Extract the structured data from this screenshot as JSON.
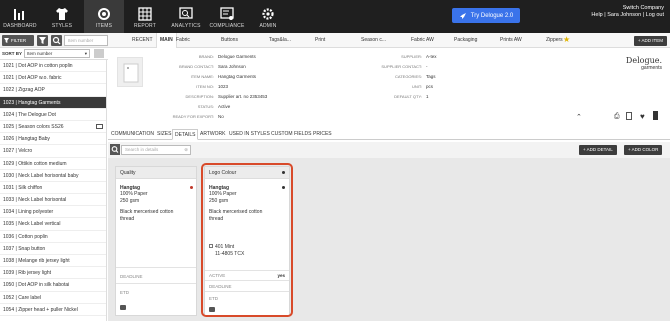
{
  "topnav": {
    "items": [
      {
        "label": "DASHBOARD",
        "icon": "dashboard-icon"
      },
      {
        "label": "STYLES",
        "icon": "tshirt-icon"
      },
      {
        "label": "ITEMS",
        "icon": "items-gear-icon"
      },
      {
        "label": "REPORT",
        "icon": "report-grid-icon"
      },
      {
        "label": "ANALYTICS",
        "icon": "analytics-icon"
      },
      {
        "label": "COMPLIANCE",
        "icon": "compliance-icon"
      },
      {
        "label": "ADMIN",
        "icon": "admin-gear-icon"
      }
    ],
    "try_label": "Try Delogue 2.0",
    "switch_company": "Switch Company",
    "user_links": "Help | Sara Johnson | Log out"
  },
  "left": {
    "filter_label": "FILTER",
    "search_placeholder": "Item number",
    "sort_by_label": "SORT BY",
    "sort_value": "Item number",
    "items": [
      "1021 | Dot AOP in cotton poplin",
      "1021 | Dot AOP w.o. fabric",
      "1022 | Zigzag AOP",
      "1023 | Hangtag Garments",
      "1024 | The Delogue Dot",
      "1025 | Season colors SS26",
      "1026 | Hangtag Baby",
      "1027 | Velcro",
      "1029 | Ottikin cotton medium",
      "1030 | Neck Label horisontal baby",
      "1031 | Silk chiffon",
      "1033 | Neck Label horisontal",
      "1034 | Lining polyester",
      "1035 | Neck Label vertical",
      "1036 | Cotton poplin",
      "1037 | Snap button",
      "1038 | Melange rib jersey light",
      "1039 | Rib jersey light",
      "1050 | Dot AOP in silk habotai",
      "1052 | Care label",
      "1054 | Zipper head + puller Nickel"
    ],
    "selected_index": 3
  },
  "tabs": {
    "items": [
      "RECENT",
      "MAIN",
      "Fabric",
      "Buttons",
      "Tags&la...",
      "Print",
      "Season c...",
      "Fabric AW",
      "Packaging",
      "Prints AW",
      "Zippers"
    ],
    "active": "MAIN",
    "add_item": "ADD ITEM"
  },
  "info": {
    "left": [
      {
        "k": "BRAND:",
        "v": "Delogue Garments"
      },
      {
        "k": "BRAND CONTACT:",
        "v": "Sara Johnson"
      },
      {
        "k": "ITEM NAME:",
        "v": "Hangtag Garments"
      },
      {
        "k": "ITEM NO:",
        "v": "1023"
      },
      {
        "k": "DESCRIPTION:",
        "v": "Supplier art. no 2353453"
      },
      {
        "k": "STATUS:",
        "v": "Active"
      },
      {
        "k": "READY FOR EXPORT:",
        "v": "No"
      }
    ],
    "right": [
      {
        "k": "SUPPLIER:",
        "v": "A-tex"
      },
      {
        "k": "SUPPLIER CONTACT:",
        "v": "-"
      },
      {
        "k": "CATEGORIES:",
        "v": "Tags"
      },
      {
        "k": "UNIT:",
        "v": "pcs"
      },
      {
        "k": "DEFAULT QTY:",
        "v": "1"
      }
    ],
    "logo": "Delogue.",
    "logo_sub": "garments"
  },
  "subtabs": {
    "items": [
      "COMMUNICATION",
      "SIZES",
      "DETAILS",
      "ARTWORK",
      "USED IN STYLES",
      "CUSTOM FIELDS",
      "PRICES"
    ],
    "active": "DETAILS"
  },
  "details": {
    "search_placeholder": "Search in details",
    "add_detail": "ADD DETAIL",
    "add_color": "ADD COLOR",
    "cards": [
      {
        "header": "Quality",
        "name": "Hangtag",
        "lines": [
          "100% Paper",
          "250 gsm",
          "",
          "Black mercerised cotton thread"
        ],
        "deadline_label": "DEADLINE",
        "etd_label": "ETD"
      },
      {
        "header": "Logo Colour",
        "name": "Hangtag",
        "lines": [
          "100% Paper",
          "250 gsm",
          "",
          "Black mercerised cotton thread"
        ],
        "color_name": "401 Mint",
        "color_code": "11-4805 TCX",
        "active_label": "ACTIVE",
        "active_value": "yes",
        "deadline_label": "DEADLINE",
        "etd_label": "ETD"
      }
    ]
  },
  "colors": {
    "accent_highlight": "#d84a2a",
    "try_button": "#3a73ea",
    "dark": "#1f1f1f"
  }
}
